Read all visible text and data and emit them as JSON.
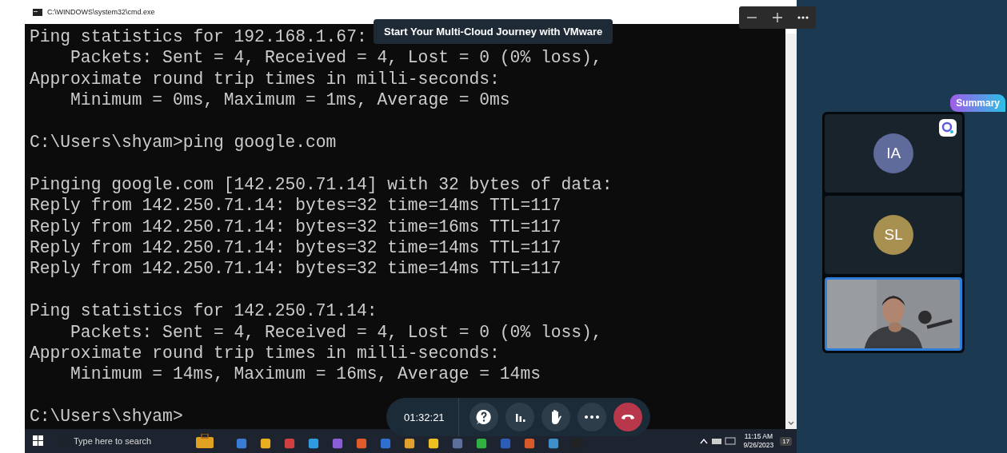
{
  "window": {
    "title": "C:\\WINDOWS\\system32\\cmd.exe"
  },
  "terminal": {
    "blocks": [
      [
        "Ping statistics for 192.168.1.67:",
        "    Packets: Sent = 4, Received = 4, Lost = 0 (0% loss),",
        "Approximate round trip times in milli-seconds:",
        "    Minimum = 0ms, Maximum = 1ms, Average = 0ms"
      ],
      [
        "C:\\Users\\shyam>ping google.com"
      ],
      [
        "Pinging google.com [142.250.71.14] with 32 bytes of data:",
        "Reply from 142.250.71.14: bytes=32 time=14ms TTL=117",
        "Reply from 142.250.71.14: bytes=32 time=16ms TTL=117",
        "Reply from 142.250.71.14: bytes=32 time=14ms TTL=117",
        "Reply from 142.250.71.14: bytes=32 time=14ms TTL=117"
      ],
      [
        "Ping statistics for 142.250.71.14:",
        "    Packets: Sent = 4, Received = 4, Lost = 0 (0% loss),",
        "Approximate round trip times in milli-seconds:",
        "    Minimum = 14ms, Maximum = 16ms, Average = 14ms"
      ],
      [
        "C:\\Users\\shyam>"
      ]
    ]
  },
  "banner": "Start Your Multi-Cloud Journey with VMware",
  "call_bar": {
    "timer": "01:32:21"
  },
  "summary_button": "Summary",
  "participants": [
    {
      "kind": "avatar",
      "initials": "IA",
      "color": "#5f6b9a",
      "selected": false
    },
    {
      "kind": "avatar",
      "initials": "SL",
      "color": "#a89050",
      "selected": false
    },
    {
      "kind": "video",
      "selected": true
    }
  ],
  "taskbar": {
    "search_placeholder": "Type here to search",
    "time": "11:15 AM",
    "date": "9/26/2023",
    "notification_count": "17"
  }
}
